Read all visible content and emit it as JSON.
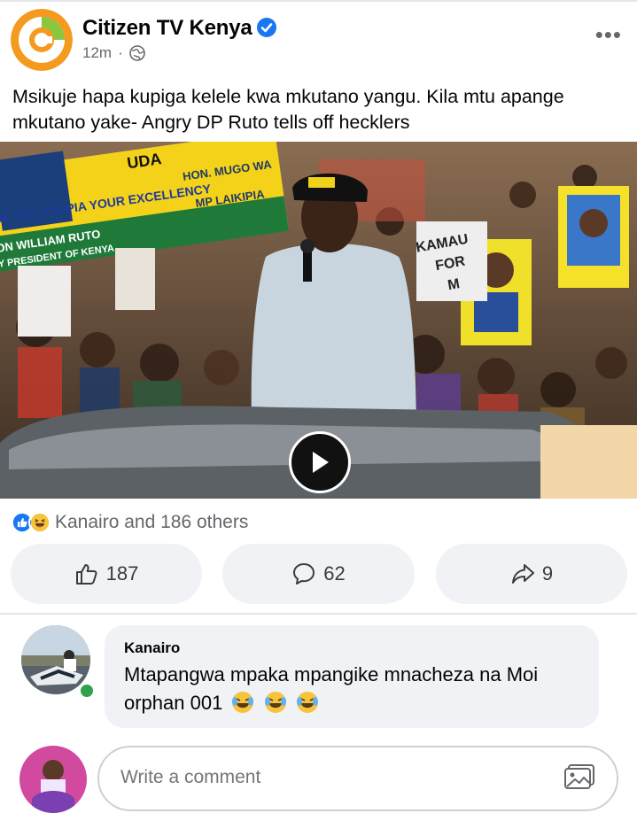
{
  "post": {
    "page_name": "Citizen TV Kenya",
    "time": "12m",
    "caption": "Msikuje hapa kupiga kelele kwa mkutano yangu. Kila mtu apange mkutano yake- Angry DP Ruto tells off hecklers",
    "video": {
      "banner_lines": [
        "ME TO LAIKIPIA YOUR EXCELLENCY",
        "ON WILLIAM RUTO",
        "Y PRESIDENT OF KENYA"
      ],
      "banner_uda": "UDA",
      "banner_mp": [
        "HON. MUGO WA",
        "MP LAIKIPIA"
      ],
      "sign_text": [
        "KAMAU",
        "FOR",
        "M"
      ]
    },
    "reactions_label": "Kanairo and 186 others",
    "actions": {
      "like_count": "187",
      "comment_count": "62",
      "share_count": "9"
    }
  },
  "comment": {
    "author": "Kanairo",
    "text": "Mtapangwa mpaka mpangike mnacheza na Moi orphan 001"
  },
  "composer": {
    "placeholder": "Write a comment"
  },
  "colors": {
    "brand_orange": "#f39a1f",
    "verified_blue": "#1877f2",
    "online_green": "#31a24c",
    "button_bg": "#f0f2f5"
  }
}
